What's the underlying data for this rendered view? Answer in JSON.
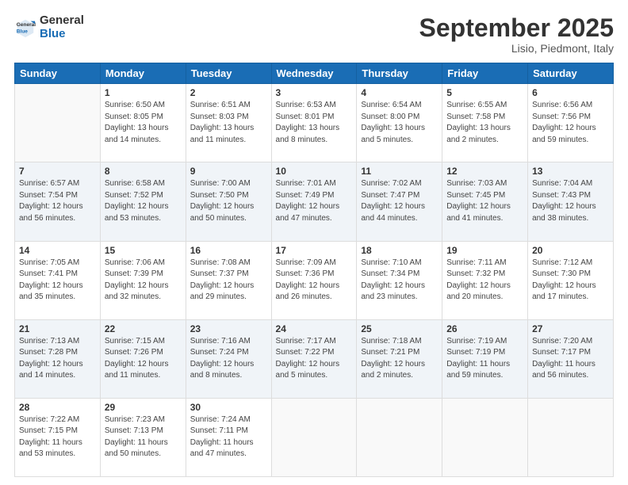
{
  "header": {
    "logo_general": "General",
    "logo_blue": "Blue",
    "month_title": "September 2025",
    "location": "Lisio, Piedmont, Italy"
  },
  "days_of_week": [
    "Sunday",
    "Monday",
    "Tuesday",
    "Wednesday",
    "Thursday",
    "Friday",
    "Saturday"
  ],
  "weeks": [
    [
      {
        "day": "",
        "sunrise": "",
        "sunset": "",
        "daylight": ""
      },
      {
        "day": "1",
        "sunrise": "Sunrise: 6:50 AM",
        "sunset": "Sunset: 8:05 PM",
        "daylight": "Daylight: 13 hours and 14 minutes."
      },
      {
        "day": "2",
        "sunrise": "Sunrise: 6:51 AM",
        "sunset": "Sunset: 8:03 PM",
        "daylight": "Daylight: 13 hours and 11 minutes."
      },
      {
        "day": "3",
        "sunrise": "Sunrise: 6:53 AM",
        "sunset": "Sunset: 8:01 PM",
        "daylight": "Daylight: 13 hours and 8 minutes."
      },
      {
        "day": "4",
        "sunrise": "Sunrise: 6:54 AM",
        "sunset": "Sunset: 8:00 PM",
        "daylight": "Daylight: 13 hours and 5 minutes."
      },
      {
        "day": "5",
        "sunrise": "Sunrise: 6:55 AM",
        "sunset": "Sunset: 7:58 PM",
        "daylight": "Daylight: 13 hours and 2 minutes."
      },
      {
        "day": "6",
        "sunrise": "Sunrise: 6:56 AM",
        "sunset": "Sunset: 7:56 PM",
        "daylight": "Daylight: 12 hours and 59 minutes."
      }
    ],
    [
      {
        "day": "7",
        "sunrise": "Sunrise: 6:57 AM",
        "sunset": "Sunset: 7:54 PM",
        "daylight": "Daylight: 12 hours and 56 minutes."
      },
      {
        "day": "8",
        "sunrise": "Sunrise: 6:58 AM",
        "sunset": "Sunset: 7:52 PM",
        "daylight": "Daylight: 12 hours and 53 minutes."
      },
      {
        "day": "9",
        "sunrise": "Sunrise: 7:00 AM",
        "sunset": "Sunset: 7:50 PM",
        "daylight": "Daylight: 12 hours and 50 minutes."
      },
      {
        "day": "10",
        "sunrise": "Sunrise: 7:01 AM",
        "sunset": "Sunset: 7:49 PM",
        "daylight": "Daylight: 12 hours and 47 minutes."
      },
      {
        "day": "11",
        "sunrise": "Sunrise: 7:02 AM",
        "sunset": "Sunset: 7:47 PM",
        "daylight": "Daylight: 12 hours and 44 minutes."
      },
      {
        "day": "12",
        "sunrise": "Sunrise: 7:03 AM",
        "sunset": "Sunset: 7:45 PM",
        "daylight": "Daylight: 12 hours and 41 minutes."
      },
      {
        "day": "13",
        "sunrise": "Sunrise: 7:04 AM",
        "sunset": "Sunset: 7:43 PM",
        "daylight": "Daylight: 12 hours and 38 minutes."
      }
    ],
    [
      {
        "day": "14",
        "sunrise": "Sunrise: 7:05 AM",
        "sunset": "Sunset: 7:41 PM",
        "daylight": "Daylight: 12 hours and 35 minutes."
      },
      {
        "day": "15",
        "sunrise": "Sunrise: 7:06 AM",
        "sunset": "Sunset: 7:39 PM",
        "daylight": "Daylight: 12 hours and 32 minutes."
      },
      {
        "day": "16",
        "sunrise": "Sunrise: 7:08 AM",
        "sunset": "Sunset: 7:37 PM",
        "daylight": "Daylight: 12 hours and 29 minutes."
      },
      {
        "day": "17",
        "sunrise": "Sunrise: 7:09 AM",
        "sunset": "Sunset: 7:36 PM",
        "daylight": "Daylight: 12 hours and 26 minutes."
      },
      {
        "day": "18",
        "sunrise": "Sunrise: 7:10 AM",
        "sunset": "Sunset: 7:34 PM",
        "daylight": "Daylight: 12 hours and 23 minutes."
      },
      {
        "day": "19",
        "sunrise": "Sunrise: 7:11 AM",
        "sunset": "Sunset: 7:32 PM",
        "daylight": "Daylight: 12 hours and 20 minutes."
      },
      {
        "day": "20",
        "sunrise": "Sunrise: 7:12 AM",
        "sunset": "Sunset: 7:30 PM",
        "daylight": "Daylight: 12 hours and 17 minutes."
      }
    ],
    [
      {
        "day": "21",
        "sunrise": "Sunrise: 7:13 AM",
        "sunset": "Sunset: 7:28 PM",
        "daylight": "Daylight: 12 hours and 14 minutes."
      },
      {
        "day": "22",
        "sunrise": "Sunrise: 7:15 AM",
        "sunset": "Sunset: 7:26 PM",
        "daylight": "Daylight: 12 hours and 11 minutes."
      },
      {
        "day": "23",
        "sunrise": "Sunrise: 7:16 AM",
        "sunset": "Sunset: 7:24 PM",
        "daylight": "Daylight: 12 hours and 8 minutes."
      },
      {
        "day": "24",
        "sunrise": "Sunrise: 7:17 AM",
        "sunset": "Sunset: 7:22 PM",
        "daylight": "Daylight: 12 hours and 5 minutes."
      },
      {
        "day": "25",
        "sunrise": "Sunrise: 7:18 AM",
        "sunset": "Sunset: 7:21 PM",
        "daylight": "Daylight: 12 hours and 2 minutes."
      },
      {
        "day": "26",
        "sunrise": "Sunrise: 7:19 AM",
        "sunset": "Sunset: 7:19 PM",
        "daylight": "Daylight: 11 hours and 59 minutes."
      },
      {
        "day": "27",
        "sunrise": "Sunrise: 7:20 AM",
        "sunset": "Sunset: 7:17 PM",
        "daylight": "Daylight: 11 hours and 56 minutes."
      }
    ],
    [
      {
        "day": "28",
        "sunrise": "Sunrise: 7:22 AM",
        "sunset": "Sunset: 7:15 PM",
        "daylight": "Daylight: 11 hours and 53 minutes."
      },
      {
        "day": "29",
        "sunrise": "Sunrise: 7:23 AM",
        "sunset": "Sunset: 7:13 PM",
        "daylight": "Daylight: 11 hours and 50 minutes."
      },
      {
        "day": "30",
        "sunrise": "Sunrise: 7:24 AM",
        "sunset": "Sunset: 7:11 PM",
        "daylight": "Daylight: 11 hours and 47 minutes."
      },
      {
        "day": "",
        "sunrise": "",
        "sunset": "",
        "daylight": ""
      },
      {
        "day": "",
        "sunrise": "",
        "sunset": "",
        "daylight": ""
      },
      {
        "day": "",
        "sunrise": "",
        "sunset": "",
        "daylight": ""
      },
      {
        "day": "",
        "sunrise": "",
        "sunset": "",
        "daylight": ""
      }
    ]
  ]
}
